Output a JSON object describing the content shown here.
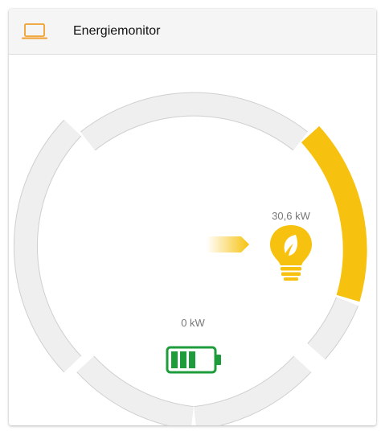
{
  "header": {
    "title": "Energiemonitor",
    "icon": "laptop-icon"
  },
  "consumption": {
    "value_label": "30,6 kW",
    "icon": "eco-lightbulb-icon"
  },
  "battery": {
    "value_label": "0 kW",
    "icon": "battery-icon",
    "charge_bars": 3
  },
  "flow": {
    "icon": "flow-arrow-icon"
  },
  "colors": {
    "consumption": "#f7c20f",
    "battery": "#1e9b3a",
    "ring_track": "#eeeeee",
    "header_icon": "#f0a030"
  }
}
